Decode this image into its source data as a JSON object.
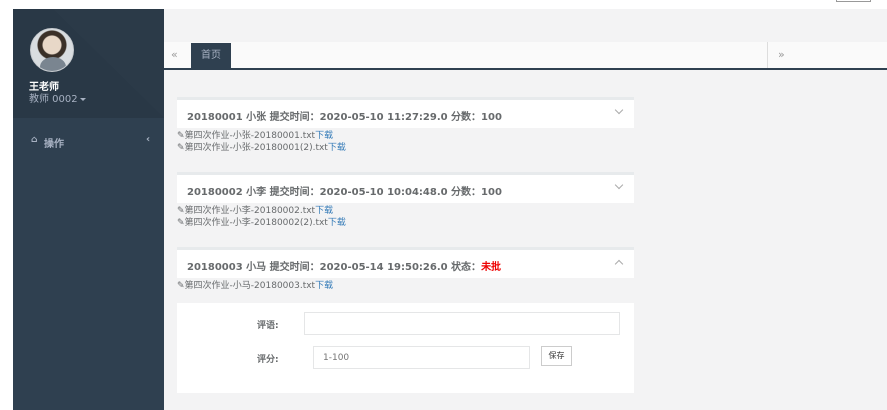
{
  "profile": {
    "name": "王老师",
    "role": "教师 0002"
  },
  "nav": {
    "items": [
      {
        "icon": "home-icon",
        "label": "操作",
        "arrow": "‹"
      }
    ]
  },
  "tabs": {
    "prev": "«",
    "next": "»",
    "items": [
      {
        "label": "首页",
        "active": true
      }
    ]
  },
  "submissions": [
    {
      "title": "20180001 小张   提交时间：2020-05-10 11:27:29.0   分数：100",
      "expanded": false,
      "files": [
        {
          "name": "✎第四次作业-小张-20180001.txt",
          "download": "下载"
        },
        {
          "name": "✎第四次作业-小张-20180001(2).txt",
          "download": "下载"
        }
      ]
    },
    {
      "title": "20180002 小李   提交时间：2020-05-10 10:04:48.0   分数：100",
      "expanded": false,
      "files": [
        {
          "name": "✎第四次作业-小李-20180002.txt",
          "download": "下载"
        },
        {
          "name": "✎第四次作业-小李-20180002(2).txt",
          "download": "下载"
        }
      ]
    },
    {
      "title": "20180003 小马   提交时间：2020-05-14 19:50:26.0   状态：",
      "status": "未批",
      "status_color": "#ed0000",
      "expanded": true,
      "files": [
        {
          "name": "✎第四次作业-小马-20180003.txt",
          "download": "下载"
        }
      ]
    }
  ],
  "grading_form": {
    "comment_label": "评语:",
    "comment_value": "",
    "score_label": "评分:",
    "score_placeholder": "1-100",
    "save_label": "保存"
  },
  "colors": {
    "sidebar": "#2f4050",
    "accent_link": "#337ab7",
    "status_unmarked": "#ed0000"
  }
}
